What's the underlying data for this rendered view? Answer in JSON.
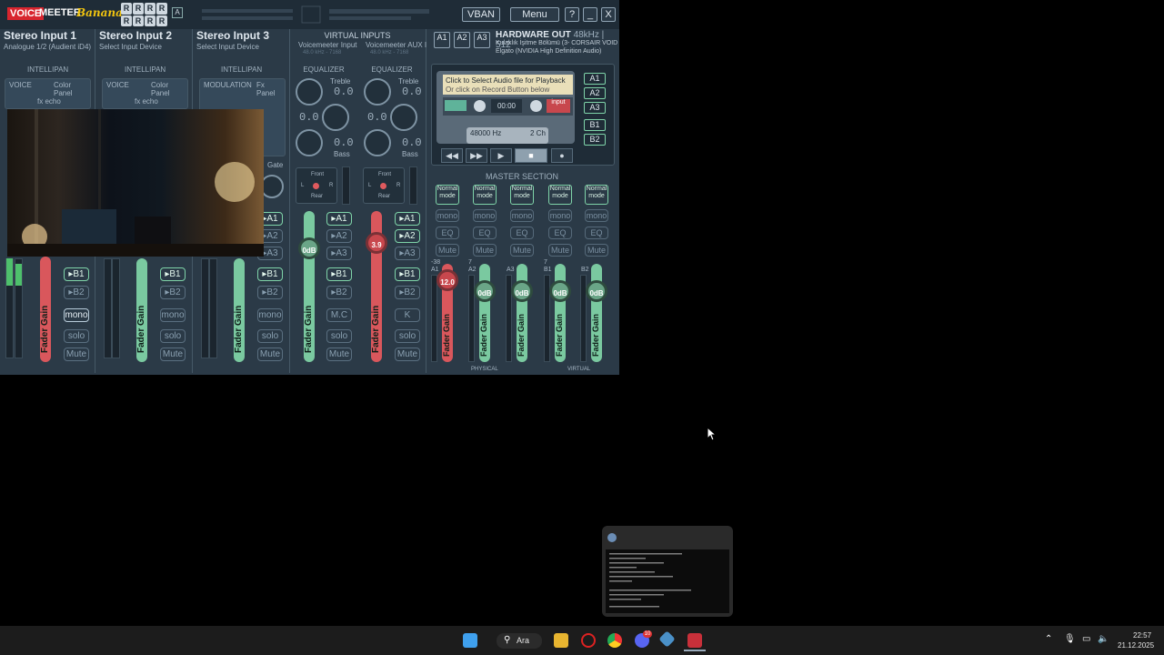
{
  "title": {
    "voice": "VOICE",
    "meeter": "MEETER",
    "banana": "Banana",
    "registration": [
      "R",
      "R",
      "R",
      "R",
      "R",
      "R",
      "R",
      "R"
    ],
    "a_badge": "A",
    "vban": "VBAN",
    "menu": "Menu",
    "help": "?",
    "minimize": "_",
    "close": "X"
  },
  "inputs": [
    {
      "title": "Stereo Input 1",
      "sub": "Analogue 1/2 (Audient iD4)",
      "intelli": "INTELLIPAN",
      "panel_label": "VOICE",
      "panel_btn": "Color Panel",
      "panel_sub": "fx echo"
    },
    {
      "title": "Stereo Input 2",
      "sub": "Select Input Device",
      "intelli": "INTELLIPAN",
      "panel_label": "VOICE",
      "panel_btn": "Color Panel",
      "panel_sub": "fx echo"
    },
    {
      "title": "Stereo Input 3",
      "sub": "Select Input Device",
      "intelli": "INTELLIPAN",
      "panel_label": "MODULATION",
      "panel_btn": "Fx Panel",
      "gate": "Gate"
    }
  ],
  "virtual": {
    "title": "VIRTUAL INPUTS",
    "ch1": "Voicemeeter Input",
    "ch1_rate": "48.0 kHz - 7168",
    "ch2": "Voicemeeter AUX I",
    "ch2_rate": "48.0 kHz - 7168",
    "eq": "EQUALIZER",
    "treble": "Treble",
    "bass": "Bass",
    "zero": "0.0",
    "front": "Front",
    "rear": "Rear",
    "l": "L",
    "r": "R"
  },
  "hardware": {
    "a1": "A1",
    "a2": "A2",
    "a3": "A3",
    "title": "HARDWARE OUT",
    "spec": "48kHz | 512",
    "dev1": "Kulaklık İşitme Bölümü (3- CORSAIR VOID",
    "dev2": "Elgato (NVIDIA High Definition Audio)"
  },
  "tape": {
    "line1": "Click to Select Audio file for Playback",
    "line2": "Or click on Record Button below",
    "time": "00:00",
    "input": "input",
    "hz": "48000 Hz",
    "ch": "2 Ch"
  },
  "buses": [
    "A1",
    "A2",
    "A3",
    "B1",
    "B2"
  ],
  "labels": {
    "mono": "mono",
    "solo": "solo",
    "mute": "Mute",
    "mc": "M.C",
    "k": "K",
    "eq": "EQ",
    "fader_gain": "Fader Gain",
    "master": "MASTER SECTION",
    "physical": "PHYSICAL",
    "virtual": "VIRTUAL",
    "normal_mode": "Normal mode"
  },
  "faders": {
    "v1": "0dB",
    "v2": "3.9",
    "m1": "12.0",
    "m2": "0dB",
    "m3": "0dB",
    "m4": "0dB",
    "m5": "0dB"
  },
  "master_tags": {
    "a1": "A1",
    "a1_db": "-38",
    "a2": "A2",
    "a3": "A3",
    "b1": "B1",
    "b2": "B2",
    "seven": "7"
  },
  "taskbar": {
    "search": "Ara",
    "time": "22:57",
    "date": "21.12.2025",
    "discord_badge": "10"
  }
}
